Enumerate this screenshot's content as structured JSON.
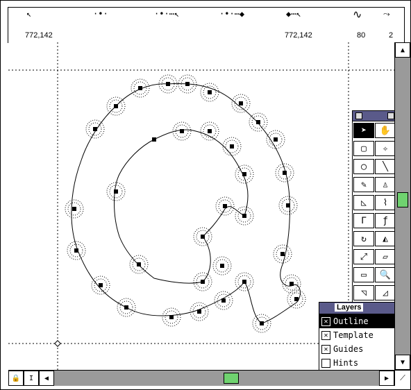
{
  "infobar": {
    "coord_left": "772,142",
    "coord_right": "772,142",
    "angle": "80",
    "count": "2"
  },
  "toolbox": {
    "tools": [
      {
        "name": "pointer-tool",
        "glyph": "➤"
      },
      {
        "name": "hand-tool",
        "glyph": "✋"
      },
      {
        "name": "rectangle-tool",
        "glyph": "▢"
      },
      {
        "name": "polygon-tool",
        "glyph": "✧"
      },
      {
        "name": "ellipse-tool",
        "glyph": "◯"
      },
      {
        "name": "line-tool",
        "glyph": "╲"
      },
      {
        "name": "freehand-tool",
        "glyph": "✎"
      },
      {
        "name": "pen-tool",
        "glyph": "♙"
      },
      {
        "name": "knife-tool",
        "glyph": "◺"
      },
      {
        "name": "bezigon-tool",
        "glyph": "⌇"
      },
      {
        "name": "corner-tool",
        "glyph": "Γ"
      },
      {
        "name": "curve-tool",
        "glyph": "ƒ"
      },
      {
        "name": "rotate-tool",
        "glyph": "↻"
      },
      {
        "name": "reflect-tool",
        "glyph": "◭"
      },
      {
        "name": "scale-tool",
        "glyph": "⤢"
      },
      {
        "name": "skew-tool",
        "glyph": "▱"
      },
      {
        "name": "measure-tool",
        "glyph": "▭"
      },
      {
        "name": "zoom-tool",
        "glyph": "🔍"
      },
      {
        "name": "trace-tool",
        "glyph": "◹"
      },
      {
        "name": "perspective-tool",
        "glyph": "◿"
      }
    ]
  },
  "layers": {
    "title": "Layers",
    "items": [
      {
        "label": "Outline",
        "checked": true,
        "selected": true
      },
      {
        "label": "Template",
        "checked": true,
        "selected": false
      },
      {
        "label": "Guides",
        "checked": true,
        "selected": false
      },
      {
        "label": "Hints",
        "checked": false,
        "selected": false
      }
    ]
  },
  "colors": {
    "highlight": "#6fd26f",
    "titlebar": "#5a5a8a",
    "scroll": "#9a9a9a"
  }
}
